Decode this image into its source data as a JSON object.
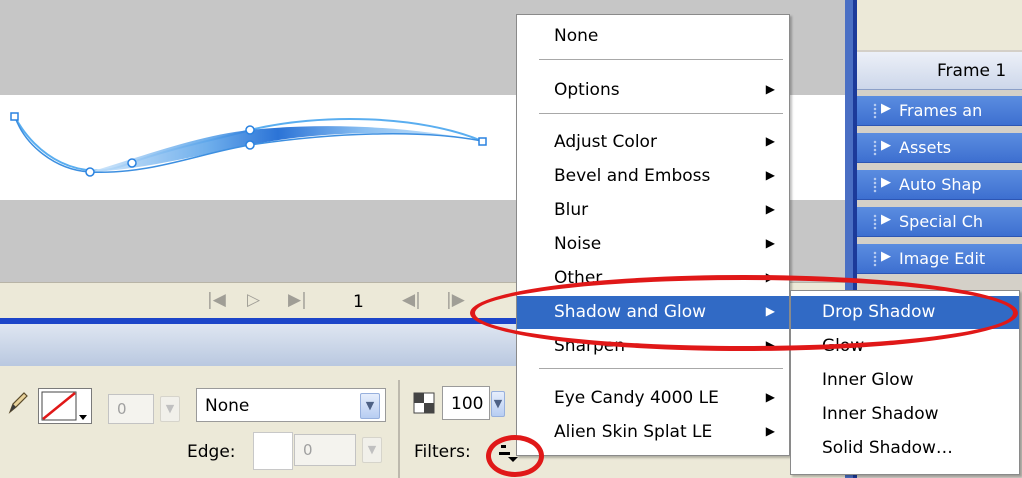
{
  "playback": {
    "frame_number": "1",
    "controls": [
      "first-frame",
      "play",
      "last-frame",
      "step-back",
      "step-forward"
    ]
  },
  "stroke": {
    "width_value": "0",
    "style_value": "None",
    "edge_label": "Edge:",
    "edge_value": "0"
  },
  "alpha": {
    "value": "100"
  },
  "filters": {
    "label": "Filters:"
  },
  "right_panel": {
    "frame_title": "Frame 1",
    "rows": [
      {
        "label": "Frames an"
      },
      {
        "label": "Assets"
      },
      {
        "label": "Auto Shap"
      },
      {
        "label": "Special Ch"
      },
      {
        "label": "Image Edit"
      }
    ]
  },
  "menu": {
    "items": [
      {
        "label": "None",
        "submenu": false
      },
      {
        "label": "Options",
        "submenu": true
      },
      {
        "label": "Adjust Color",
        "submenu": true
      },
      {
        "label": "Bevel and Emboss",
        "submenu": true
      },
      {
        "label": "Blur",
        "submenu": true
      },
      {
        "label": "Noise",
        "submenu": true
      },
      {
        "label": "Other",
        "submenu": true
      },
      {
        "label": "Shadow and Glow",
        "submenu": true,
        "highlighted": true
      },
      {
        "label": "Sharpen",
        "submenu": true
      },
      {
        "label": "Eye Candy 4000 LE",
        "submenu": true
      },
      {
        "label": "Alien Skin Splat LE",
        "submenu": true
      }
    ]
  },
  "submenu": {
    "items": [
      {
        "label": "Drop Shadow",
        "highlighted": true
      },
      {
        "label": "Glow"
      },
      {
        "label": "Inner Glow"
      },
      {
        "label": "Inner Shadow"
      },
      {
        "label": "Solid Shadow…"
      }
    ]
  },
  "colors": {
    "highlight": "#316ac5",
    "annotation": "#e01818",
    "panel_blue": "#3d6fd0"
  }
}
